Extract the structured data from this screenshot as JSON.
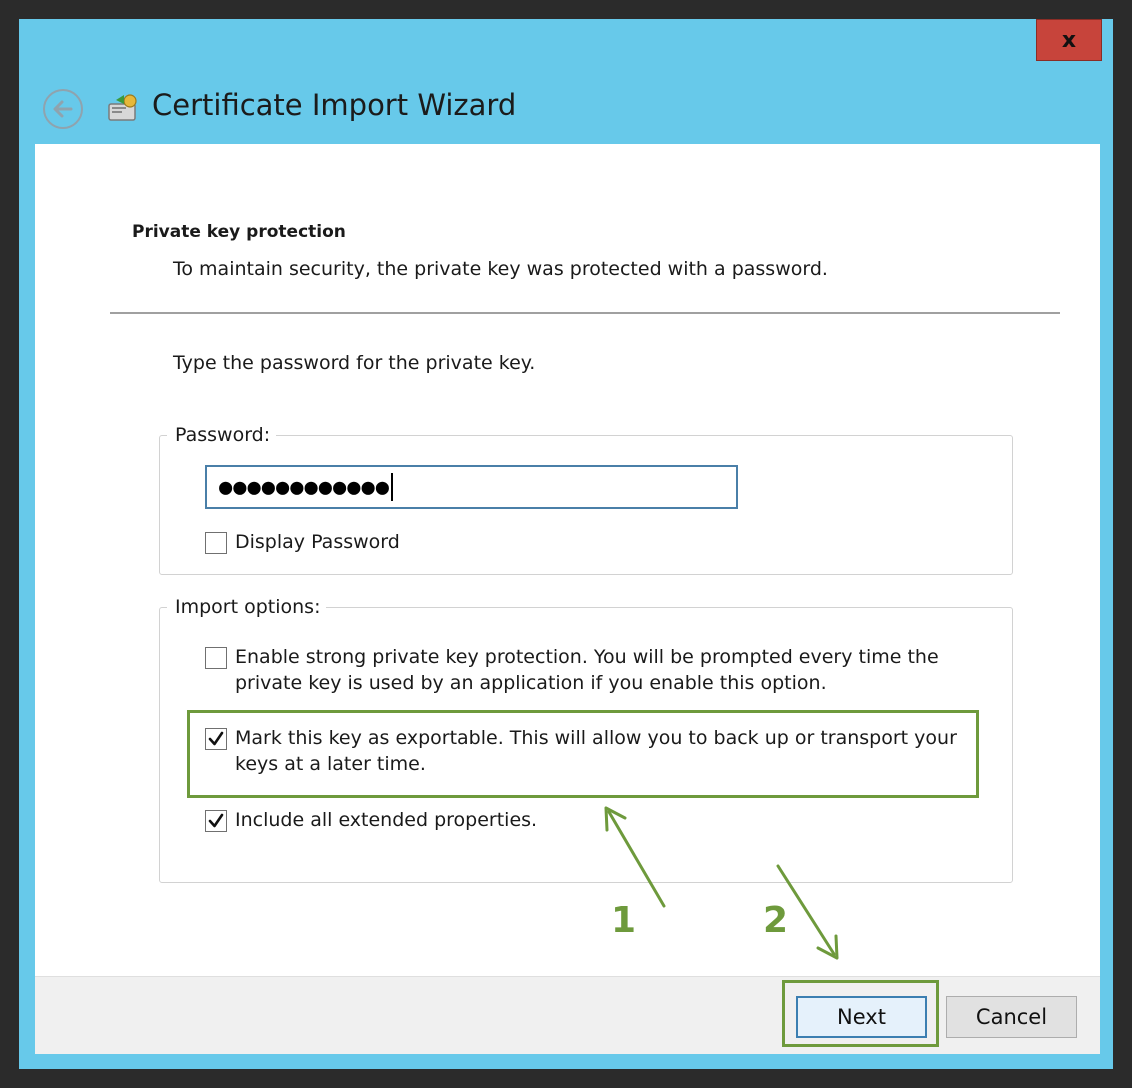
{
  "window": {
    "title": "Certificate Import Wizard",
    "close_label": "x"
  },
  "header": {
    "section_title": "Private key protection",
    "section_desc": "To maintain security, the private key was protected with a password."
  },
  "main": {
    "instruction": "Type the password for the private key.",
    "password_group_label": "Password:",
    "password_value": "●●●●●●●●●●●●",
    "display_password_label": "Display Password",
    "display_password_checked": false,
    "import_group_label": "Import options:",
    "options": [
      {
        "line1": "Enable strong private key protection. You will be prompted every time the",
        "line2": "private key is used by an application if you enable this option.",
        "checked": false
      },
      {
        "line1": "Mark this key as exportable. This will allow you to back up or transport your",
        "line2": "keys at a later time.",
        "checked": true
      },
      {
        "line1": "Include all extended properties.",
        "line2": "",
        "checked": true
      }
    ]
  },
  "footer": {
    "next_label": "Next",
    "cancel_label": "Cancel"
  },
  "annotations": {
    "step1": "1",
    "step2": "2",
    "color": "#6e9a3c"
  },
  "colors": {
    "titlebar": "#67c9ea",
    "close_button": "#c7443b",
    "input_border": "#4a7fa8"
  }
}
